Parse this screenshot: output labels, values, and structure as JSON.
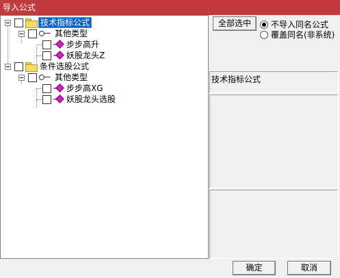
{
  "window": {
    "title": "导入公式"
  },
  "tree": {
    "nodes": [
      {
        "label": "技术指标公式",
        "selected": true
      },
      {
        "label": "其他类型"
      },
      {
        "label": "步步高升"
      },
      {
        "label": "妖股龙头Z"
      },
      {
        "label": "条件选股公式"
      },
      {
        "label": "其他类型"
      },
      {
        "label": "步步高XG"
      },
      {
        "label": "妖股龙头选股"
      }
    ]
  },
  "actions": {
    "select_all": "全部选中",
    "ok": "确定",
    "cancel": "取消"
  },
  "options": {
    "no_import_same_name": "不导入同名公式",
    "overwrite_same_name": "覆盖同名(非系统)",
    "selected": "no_import_same_name"
  },
  "info": {
    "title": "技术指标公式"
  },
  "colors": {
    "titlebar": "#c23a3c",
    "selection": "#0a64c8"
  }
}
